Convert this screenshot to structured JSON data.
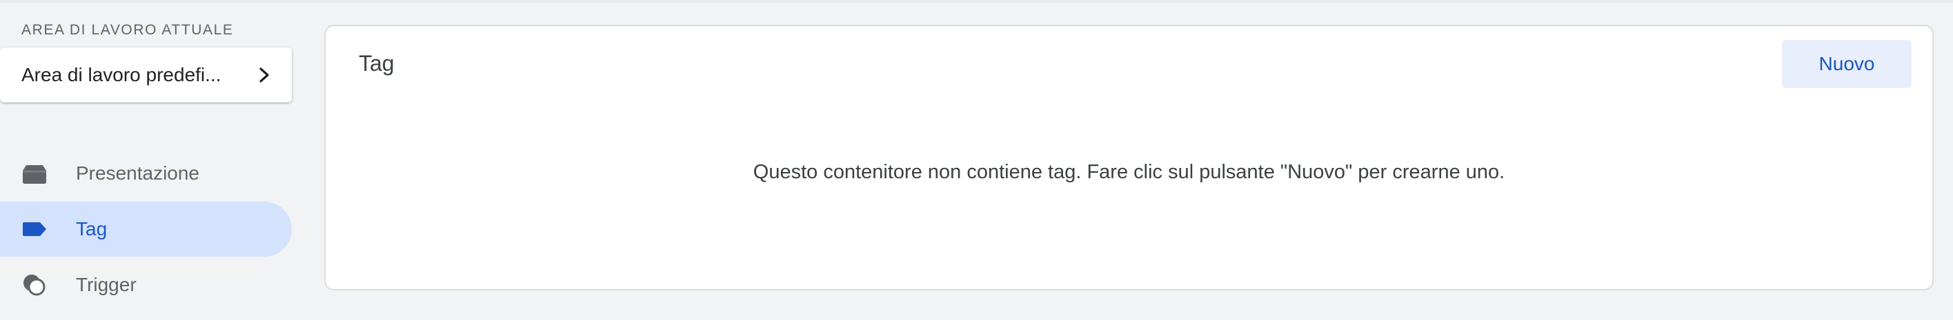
{
  "sidebar": {
    "section_label": "AREA DI LAVORO ATTUALE",
    "workspace": {
      "name": "Area di lavoro predefi...",
      "icon": "chevron-right-icon"
    },
    "nav_items": [
      {
        "label": "Presentazione",
        "icon": "overview-folder-icon",
        "active": false
      },
      {
        "label": "Tag",
        "icon": "tag-icon",
        "active": true
      },
      {
        "label": "Trigger",
        "icon": "trigger-icon",
        "active": false
      }
    ]
  },
  "main": {
    "title": "Tag",
    "new_button_label": "Nuovo",
    "empty_message": "Questo contenitore non contiene tag. Fare clic sul pulsante \"Nuovo\" per crearne uno."
  },
  "colors": {
    "background": "#f1f3f4",
    "accent": "#1a56c4",
    "active_nav_bg": "#d3e3fd",
    "button_bg": "#e8eefb",
    "icon_gray": "#5f6368"
  }
}
